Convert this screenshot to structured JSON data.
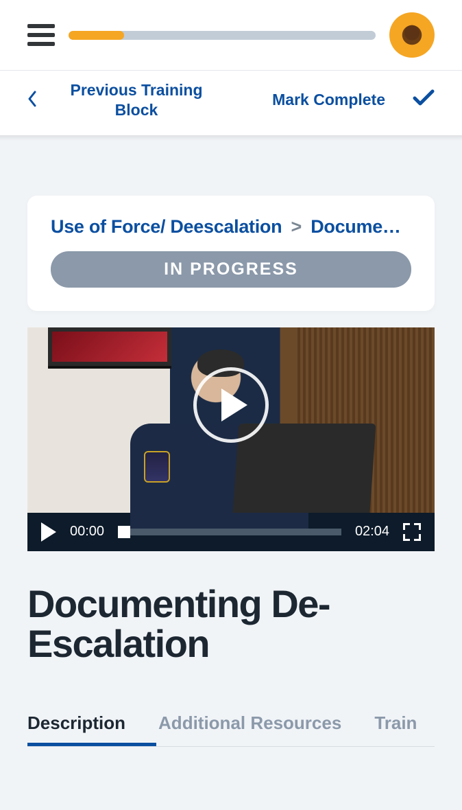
{
  "header": {
    "progress_percent": 18
  },
  "subnav": {
    "previous_label": "Previous Training Block",
    "mark_complete_label": "Mark Complete"
  },
  "breadcrumb": {
    "parent": "Use of Force/ Deescalation",
    "current": "Docume…"
  },
  "status": {
    "label": "IN PROGRESS"
  },
  "video": {
    "current_time": "00:00",
    "duration": "02:04"
  },
  "title": "Documenting De-Escalation",
  "tabs": {
    "items": [
      {
        "label": "Description",
        "active": true
      },
      {
        "label": "Additional Resources",
        "active": false
      },
      {
        "label": "Train",
        "active": false
      }
    ]
  }
}
